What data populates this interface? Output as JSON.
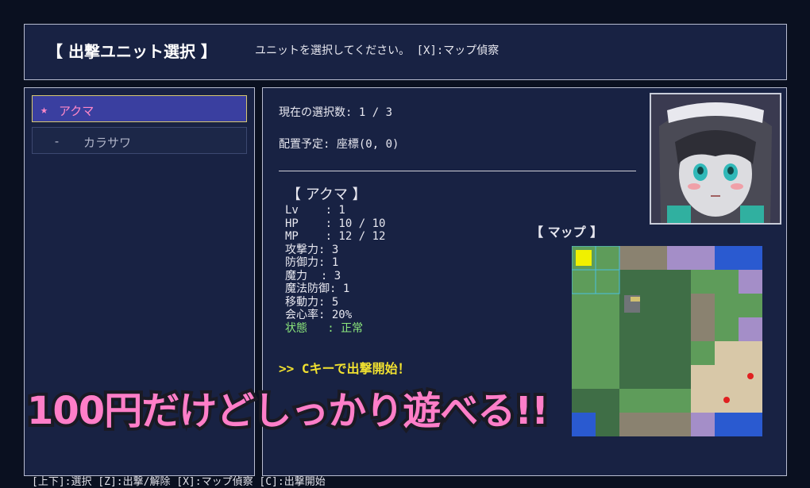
{
  "header": {
    "title": "【 出撃ユニット選択 】",
    "message": "ユニットを選択してください。 [X]:マップ偵察"
  },
  "units": [
    {
      "marker": "★",
      "name": "アクマ"
    },
    {
      "marker": "-",
      "name": "カラサワ"
    }
  ],
  "info": {
    "selection_count": "現在の選択数: 1 / 3",
    "placement": "配置予定: 座標(0, 0)"
  },
  "unit_detail": {
    "name": "【 アクマ 】",
    "stats": [
      "Lv    : 1",
      "HP    : 10 / 10",
      "MP    : 12 / 12",
      "攻撃力: 3",
      "防御力: 1",
      "魔力  : 3",
      "魔法防御: 1",
      "移動力: 5",
      "会心率: 20%"
    ],
    "status": "状態   : 正常"
  },
  "launch_hint": ">> Cキーで出撃開始！",
  "map": {
    "label": "【 マップ 】"
  },
  "banner": "100円だけどしっかり遊べる!!",
  "footer": "[上下]:選択  [Z]:出撃/解除  [X]:マップ偵察  [C]:出撃開始",
  "colors": {
    "panel": "#182243",
    "selected_unit": "#3a3fa0",
    "launch_text": "#f0e030",
    "banner": "#ff7ec8",
    "status_ok": "#8ce87c"
  }
}
